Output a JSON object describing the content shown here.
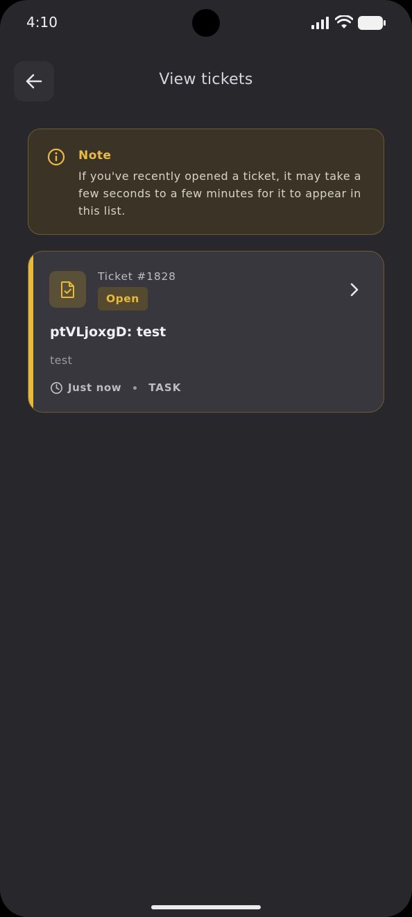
{
  "status_bar": {
    "time": "4:10",
    "icons": [
      "signal-icon",
      "wifi-icon",
      "battery-icon"
    ]
  },
  "header": {
    "back_icon": "arrow-left-icon",
    "title": "View tickets"
  },
  "note": {
    "icon": "info-icon",
    "title": "Note",
    "text": "If you've recently opened a ticket, it may take a few seconds to a few minutes for it to appear in this list."
  },
  "tickets": [
    {
      "icon": "document-check-icon",
      "number": "Ticket #1828",
      "status": "Open",
      "title": "ptVLjoxgD: test",
      "description": "test",
      "time": "Just now",
      "type": "TASK",
      "accent_color": "#e8b93b"
    }
  ],
  "colors": {
    "background": "#28272c",
    "accent": "#e8b93b",
    "note_background": "#3b3426",
    "card_background": "#38373d"
  }
}
